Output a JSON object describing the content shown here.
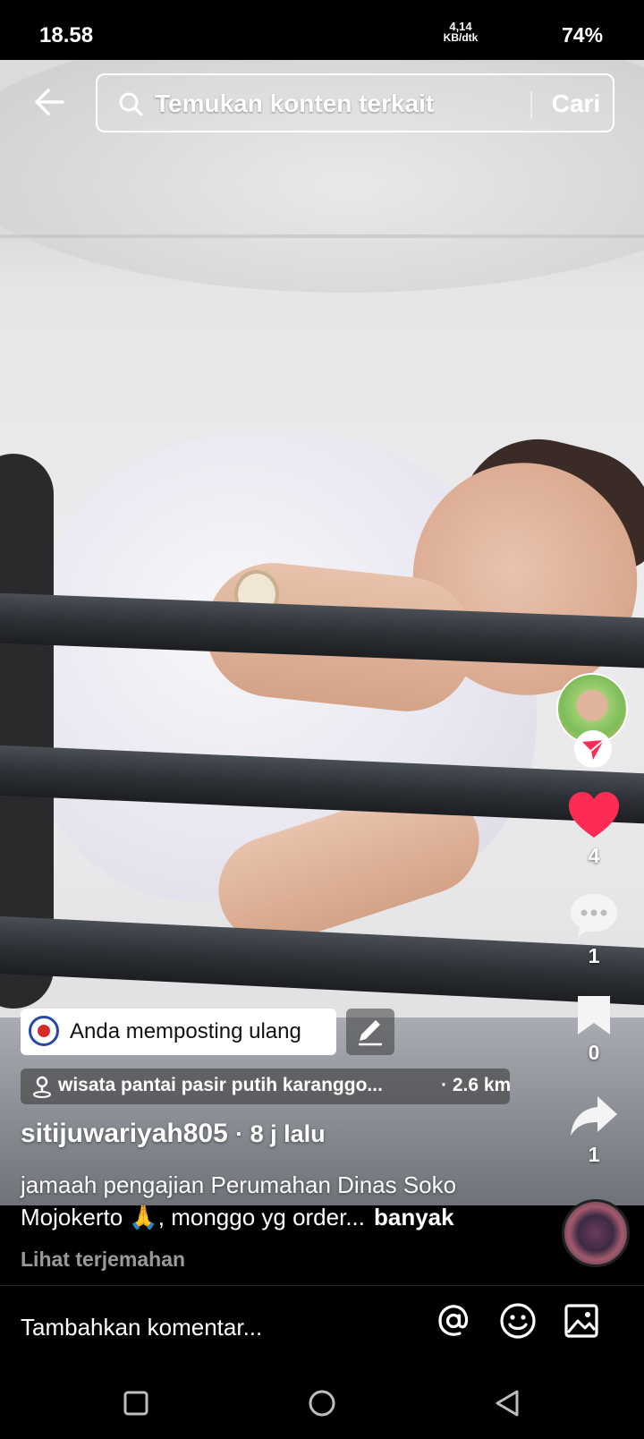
{
  "status_bar": {
    "time": "18.58",
    "network_speed": "4,14",
    "network_unit": "KB/dtk",
    "battery": "74%"
  },
  "search": {
    "placeholder": "Temukan konten terkait",
    "button_label": "Cari"
  },
  "video": {
    "repost_label": "Anda memposting ulang",
    "location_name": "wisata pantai pasir putih karanggo...",
    "location_distance": "· 2.6 km",
    "author": "sitijuwariyah805",
    "posted_ago": "· 8 j lalu",
    "caption": "jamaah pengajian Perumahan Dinas Soko Mojokerto 🙏, monggo yg order...",
    "caption_more": "banyak",
    "translate_label": "Lihat terjemahan"
  },
  "actions": {
    "like_count": "4",
    "comment_count": "1",
    "save_count": "0",
    "share_count": "1"
  },
  "comment_bar": {
    "placeholder": "Tambahkan komentar..."
  },
  "colors": {
    "like_red": "#fe2c55",
    "follow_red": "#fe2c55",
    "muted_text": "#9a9a9a"
  },
  "icons": {
    "back": "arrow-left-icon",
    "search": "search-icon",
    "follow": "paper-plane-icon",
    "like": "heart-icon",
    "comment": "comment-bubble-icon",
    "save": "bookmark-icon",
    "share": "share-arrow-icon",
    "edit": "pencil-icon",
    "location": "location-pin-icon",
    "mention": "at-sign-icon",
    "emoji": "smiley-icon",
    "image": "image-icon"
  }
}
